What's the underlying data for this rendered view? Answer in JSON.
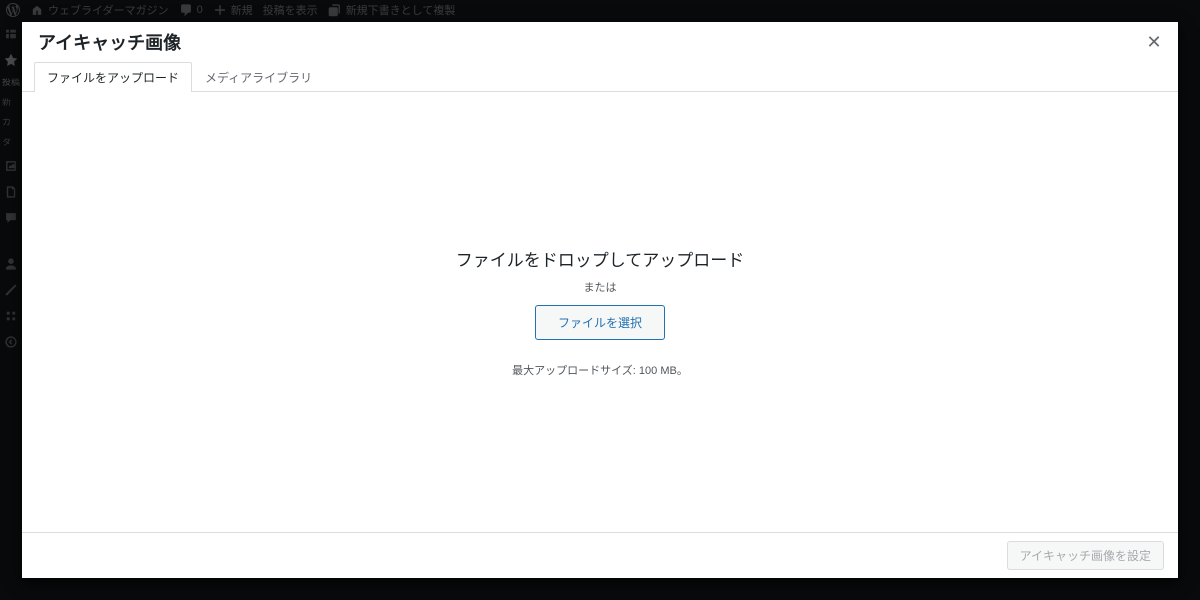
{
  "adminbar": {
    "site_name": "ウェブライダーマガジン",
    "comments": "0",
    "new_label": "新規",
    "view_post": "投稿を表示",
    "duplicate": "新規下書きとして複製"
  },
  "sidebar": {
    "items": [
      "投稿",
      "新",
      "カ",
      "タ"
    ]
  },
  "modal": {
    "title": "アイキャッチ画像",
    "tabs": {
      "upload": "ファイルをアップロード",
      "library": "メディアライブラリ"
    },
    "upload": {
      "drop_text": "ファイルをドロップしてアップロード",
      "or": "または",
      "select_btn": "ファイルを選択",
      "max_size": "最大アップロードサイズ: 100 MB。"
    },
    "footer": {
      "set_button": "アイキャッチ画像を設定"
    }
  }
}
